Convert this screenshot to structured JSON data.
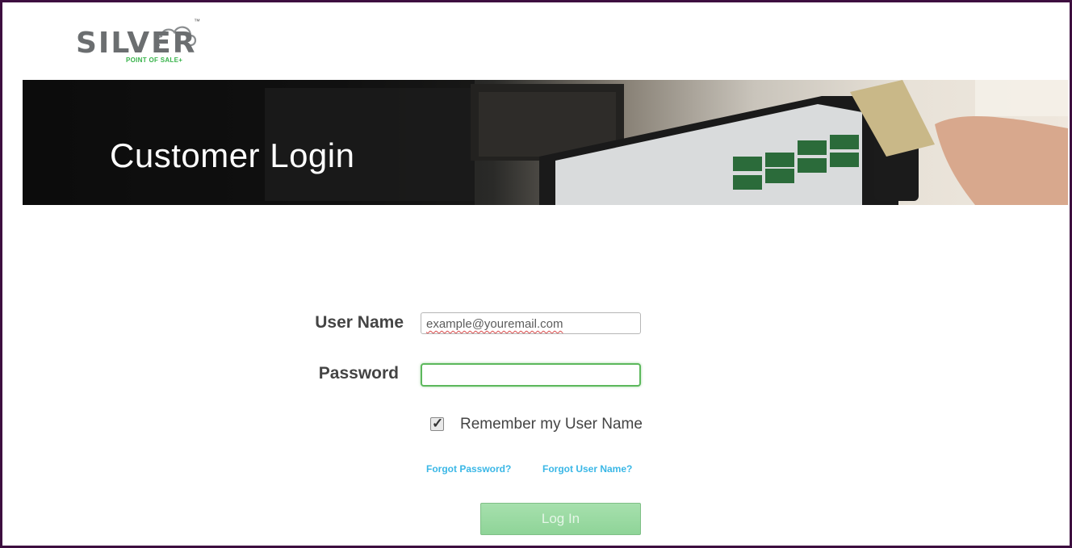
{
  "logo": {
    "word": "SILVER",
    "tm": "™",
    "tagline": "POINT OF SALE+"
  },
  "banner": {
    "title": "Customer Login"
  },
  "form": {
    "username_label": "User Name",
    "username_placeholder": "example@youremail.com",
    "password_label": "Password",
    "password_value": "",
    "remember_label": "Remember my User Name",
    "remember_checked": true,
    "forgot_password": "Forgot Password?",
    "forgot_username": "Forgot User Name?",
    "login_button": "Log In"
  },
  "colors": {
    "frame": "#3d0f3f",
    "link": "#3ab7e6",
    "button": "#8fd498",
    "focus": "#5cb85c"
  }
}
